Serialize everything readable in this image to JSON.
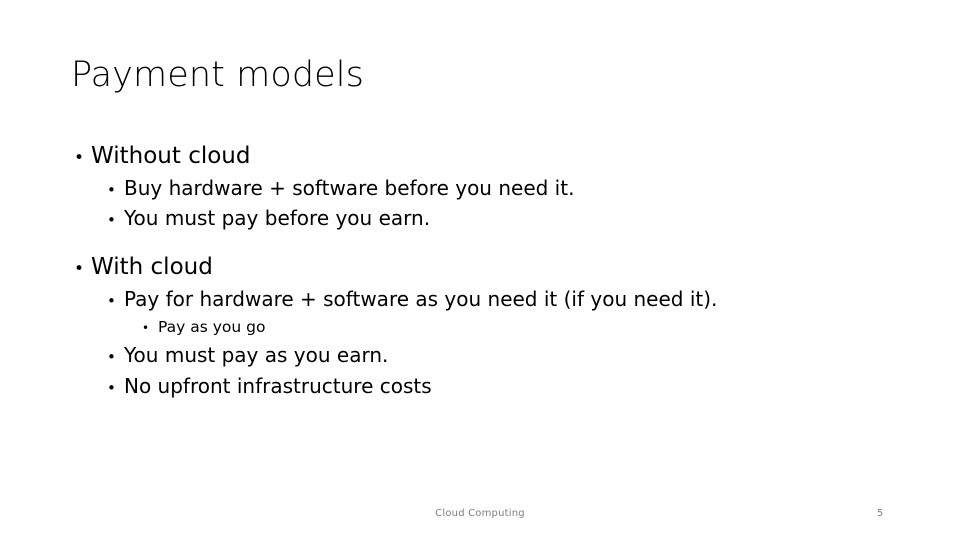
{
  "slide": {
    "title": "Payment models",
    "background_color": "#ffffff",
    "text_color": "#000000",
    "footer_color": "#7f7f7f",
    "bullet_marker": "•",
    "content": [
      {
        "level": 1,
        "text": "Without cloud"
      },
      {
        "level": 2,
        "text": "Buy hardware + software before you need it."
      },
      {
        "level": 2,
        "text": "You must pay before you earn."
      },
      {
        "level": 1,
        "text": "With cloud"
      },
      {
        "level": 2,
        "text": "Pay for hardware + software as you need it (if you need it)."
      },
      {
        "level": 3,
        "text": "Pay as you go"
      },
      {
        "level": 2,
        "text": "You must pay as you earn."
      },
      {
        "level": 2,
        "text": "No upfront infrastructure costs"
      }
    ],
    "footer": {
      "label": "Cloud Computing",
      "slide_number": "5"
    }
  }
}
